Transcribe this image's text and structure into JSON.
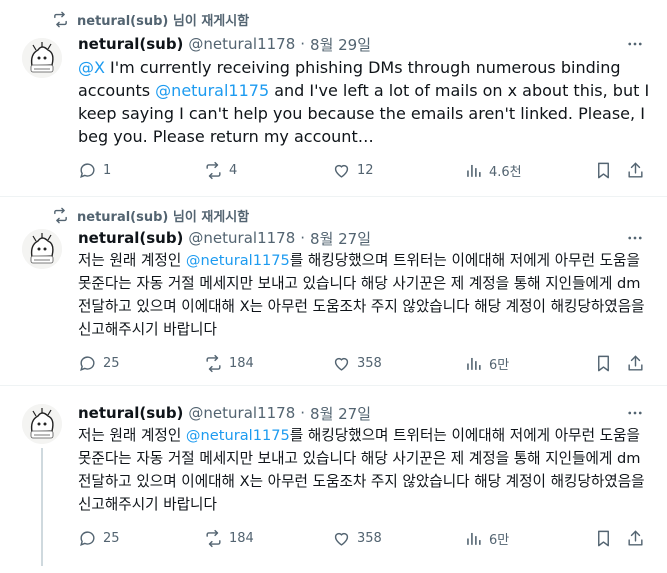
{
  "tweets": [
    {
      "repost_label": "netural(sub) 님이 재게시함",
      "display_name": "netural(sub)",
      "handle": "@netural1178",
      "dot": "·",
      "date": "8월 29일",
      "text_segments": [
        {
          "type": "mention",
          "text": "@X"
        },
        {
          "type": "text",
          "text": " I'm currently receiving phishing DMs through numerous binding accounts "
        },
        {
          "type": "mention",
          "text": "@netural1175"
        },
        {
          "type": "text",
          "text": " and I've left a lot of mails on x about this, but I keep saying I can't help you because the emails aren't linked. Please, I beg you. Please return my account…"
        }
      ],
      "replies": "1",
      "reposts": "4",
      "likes": "12",
      "views": "4.6천"
    },
    {
      "repost_label": "netural(sub) 님이 재게시함",
      "display_name": "netural(sub)",
      "handle": "@netural1178",
      "dot": "·",
      "date": "8월 27일",
      "text_segments": [
        {
          "type": "text",
          "text": "저는 원래 계정인 "
        },
        {
          "type": "mention",
          "text": "@netural1175"
        },
        {
          "type": "text",
          "text": "를 해킹당했으며 트위터는 이에대해 저에게 아무런 도움을 못준다는 자동 거절 메세지만 보내고 있습니다 해당 사기꾼은 제 계정을 통해 지인들에게 dm 전달하고 있으며 이에대해 X는 아무런 도움조차 주지 않았습니다 해당 계정이 해킹당하였음을 신고해주시기 바랍니다"
        }
      ],
      "replies": "25",
      "reposts": "184",
      "likes": "358",
      "views": "6만"
    },
    {
      "repost_label": "",
      "display_name": "netural(sub)",
      "handle": "@netural1178",
      "dot": "·",
      "date": "8월 27일",
      "text_segments": [
        {
          "type": "text",
          "text": "저는 원래 계정인 "
        },
        {
          "type": "mention",
          "text": "@netural1175"
        },
        {
          "type": "text",
          "text": "를 해킹당했으며 트위터는 이에대해 저에게 아무런 도움을 못준다는 자동 거절 메세지만 보내고 있습니다 해당 사기꾼은 제 계정을 통해 지인들에게 dm 전달하고 있으며 이에대해 X는 아무런 도움조차 주지 않았습니다 해당 계정이 해킹당하였음을 신고해주시기 바랍니다"
        }
      ],
      "replies": "25",
      "reposts": "184",
      "likes": "358",
      "views": "6만"
    }
  ],
  "colors": {
    "text": "#0f1419",
    "secondary": "#536471",
    "mention": "#1d9bf0",
    "divider": "#eff3f4",
    "thread": "#cfd9de"
  },
  "icons": [
    "repost-icon",
    "more-icon",
    "reply-icon",
    "like-icon",
    "views-icon",
    "bookmark-icon",
    "share-icon"
  ]
}
